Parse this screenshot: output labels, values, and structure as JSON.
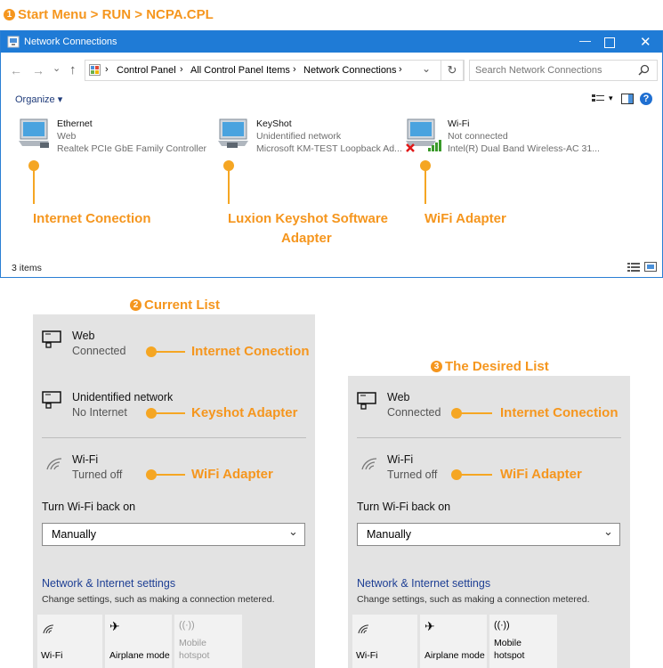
{
  "step1": {
    "num": "1",
    "title": "Start Menu > RUN > NCPA.CPL"
  },
  "window": {
    "title": "Network Connections",
    "breadcrumb": [
      "Control Panel",
      "All Control Panel Items",
      "Network Connections"
    ],
    "search_placeholder": "Search Network Connections",
    "organize_label": "Organize ▾",
    "status": "3 items",
    "adapters": [
      {
        "name": "Ethernet",
        "status": "Web",
        "device": "Realtek PCIe GbE Family Controller"
      },
      {
        "name": "KeyShot",
        "status": "Unidentified network",
        "device": "Microsoft KM-TEST Loopback Ad..."
      },
      {
        "name": "Wi-Fi",
        "status": "Not connected",
        "device": "Intel(R) Dual Band Wireless-AC 31..."
      }
    ]
  },
  "annotations": {
    "internet": "Internet Conection",
    "keyshot_line1": "Luxion Keyshot Software",
    "keyshot_line2": "Adapter",
    "wifi": "WiFi Adapter",
    "keyshot_short": "Keyshot Adapter"
  },
  "step2": {
    "num": "2",
    "title": "Current List"
  },
  "step3": {
    "num": "3",
    "title": "The Desired List"
  },
  "flyout": {
    "web": {
      "title": "Web",
      "status": "Connected"
    },
    "unidentified": {
      "title": "Unidentified network",
      "status": "No Internet"
    },
    "wifi": {
      "title": "Wi-Fi",
      "status": "Turned off"
    },
    "turn_on_label": "Turn Wi-Fi back on",
    "dropdown_value": "Manually",
    "settings_title": "Network & Internet settings",
    "settings_sub": "Change settings, such as making a connection metered.",
    "tiles": [
      {
        "label": "Wi-Fi",
        "icon": "wifi-icon"
      },
      {
        "label": "Airplane mode",
        "icon": "airplane-icon"
      },
      {
        "label_line1": "Mobile",
        "label_line2": "hotspot",
        "icon": "hotspot-icon"
      }
    ]
  },
  "colors": {
    "accent": "#f5961e",
    "titlebar": "#1f7bd6",
    "link": "#1e3f94",
    "panel": "#e3e3e3"
  }
}
